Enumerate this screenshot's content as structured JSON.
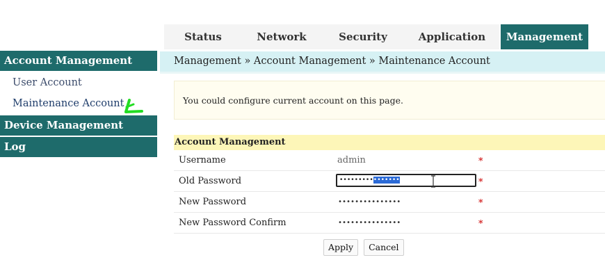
{
  "nav": {
    "tabs": [
      {
        "label": "Status"
      },
      {
        "label": "Network"
      },
      {
        "label": "Security"
      },
      {
        "label": "Application"
      },
      {
        "label": "Management",
        "active": true
      }
    ]
  },
  "sidebar": {
    "sections": [
      {
        "label": "Account Management",
        "items": [
          {
            "label": "User Account"
          },
          {
            "label": "Maintenance Account",
            "active": true
          }
        ]
      },
      {
        "label": "Device Management"
      },
      {
        "label": "Log"
      }
    ]
  },
  "breadcrumb": "Management » Account Management » Maintenance Account",
  "info_text": "You could configure current account on this page.",
  "form": {
    "section_title": "Account Management",
    "rows": [
      {
        "label": "Username",
        "value": "admin",
        "required": "*"
      },
      {
        "label": "Old Password",
        "value_masked": "•••••••••",
        "value_selected": "•••••••",
        "required": "*"
      },
      {
        "label": "New Password",
        "value_masked": "•••••••••••••••",
        "required": "*"
      },
      {
        "label": "New Password Confirm",
        "value_masked": "•••••••••••••••",
        "required": "*"
      }
    ]
  },
  "buttons": {
    "apply": "Apply",
    "cancel": "Cancel"
  },
  "colors": {
    "brand": "#1e6b6b",
    "breadcrumb_bg": "#d6f1f4",
    "section_bg": "#fdf6b8",
    "selection": "#2b6ad6",
    "annotation": "#22dd22"
  },
  "icons": {
    "text_cursor": "text-cursor-icon",
    "annotation": "check-mark-annotation-icon"
  }
}
